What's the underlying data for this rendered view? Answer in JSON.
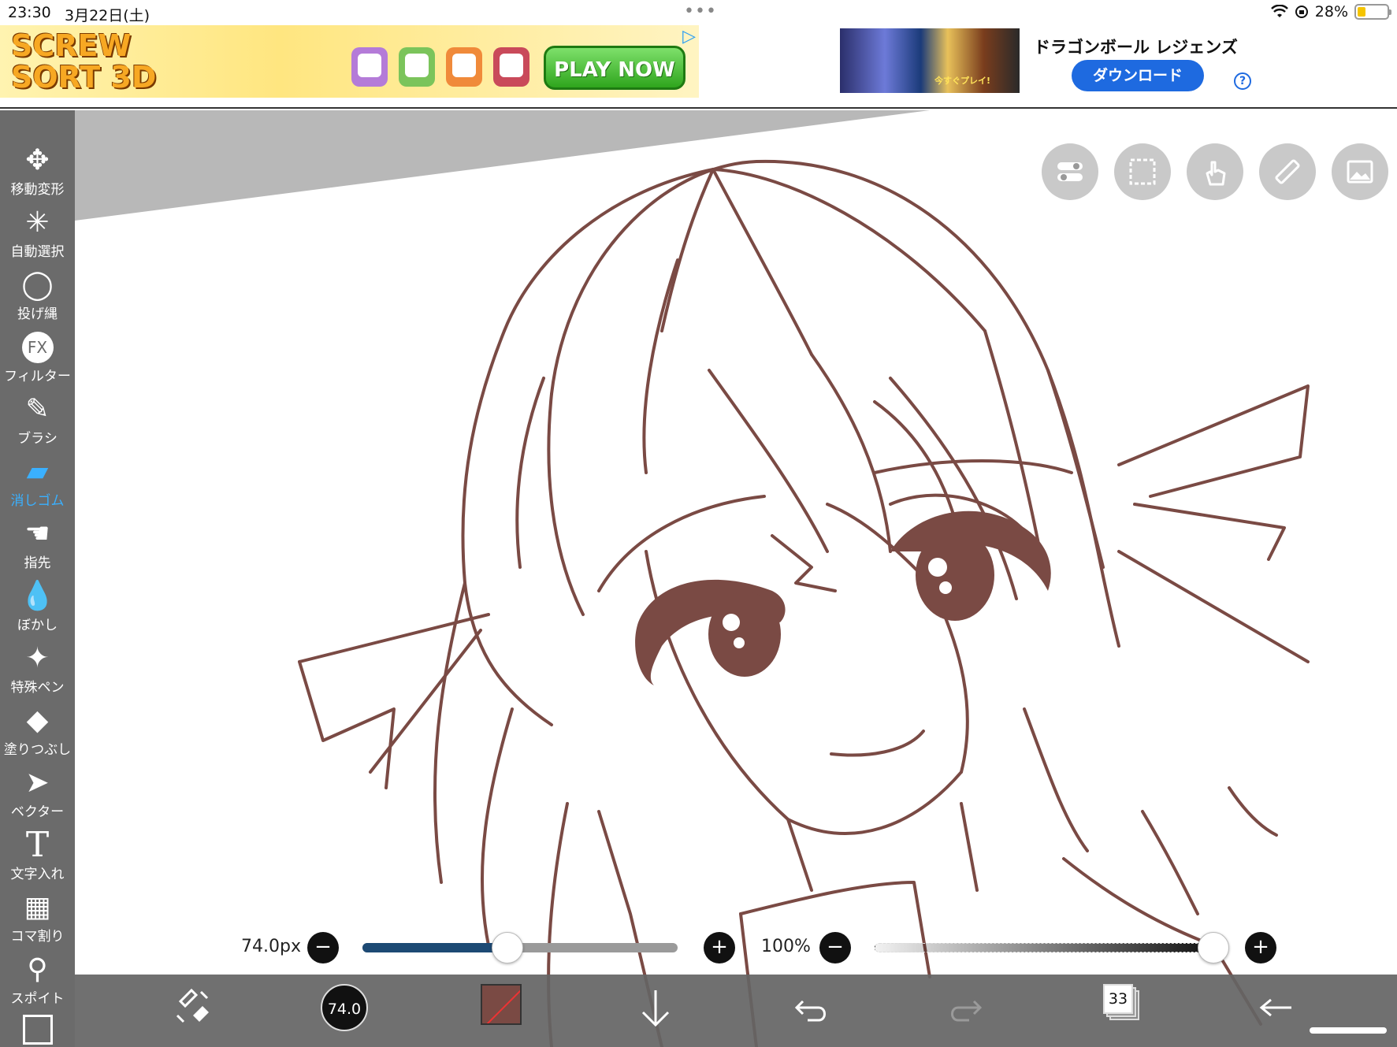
{
  "status": {
    "time": "23:30",
    "date": "3月22日(土)",
    "dots": "•••",
    "battery_pct": "28%",
    "battery_level": 0.28
  },
  "ads": {
    "left": {
      "title_line1": "SCREW",
      "title_line2": "SORT 3D",
      "cta": "PLAY NOW",
      "dice_colors": [
        "#b47bd8",
        "#7bc45b",
        "#f08a3a",
        "#c94a5a"
      ]
    },
    "right": {
      "title": "ドラゴンボール レジェンズ",
      "thumb_caption": "今すぐプレイ!",
      "cta": "ダウンロード",
      "help": "?"
    }
  },
  "toolbar": {
    "items": [
      {
        "label": "移動変形",
        "icon": "move-arrows-icon"
      },
      {
        "label": "自動選択",
        "icon": "magic-wand-icon"
      },
      {
        "label": "投げ縄",
        "icon": "lasso-icon"
      },
      {
        "label": "フィルター",
        "icon": "fx-icon",
        "icon_text": "FX"
      },
      {
        "label": "ブラシ",
        "icon": "brush-icon"
      },
      {
        "label": "消しゴム",
        "icon": "eraser-icon",
        "active": true
      },
      {
        "label": "指先",
        "icon": "finger-icon"
      },
      {
        "label": "ぼかし",
        "icon": "drop-icon"
      },
      {
        "label": "特殊ペン",
        "icon": "sparkle-pen-icon"
      },
      {
        "label": "塗りつぶし",
        "icon": "bucket-icon"
      },
      {
        "label": "ベクター",
        "icon": "vector-arrow-icon"
      },
      {
        "label": "文字入れ",
        "icon": "text-icon",
        "icon_text": "T"
      },
      {
        "label": "コマ割り",
        "icon": "panel-icon"
      },
      {
        "label": "スポイト",
        "icon": "eyedropper-icon"
      }
    ]
  },
  "top_buttons": [
    "toggle-icon",
    "selection-icon",
    "hand-icon",
    "ruler-icon",
    "image-icon"
  ],
  "brush": {
    "size_label": "74.0px",
    "size_level": 0.46,
    "opacity_label": "100%",
    "opacity_level": 1.0,
    "minus": "−",
    "plus": "+"
  },
  "bottom": {
    "brush_size_badge": "74.0",
    "layer_count": "33",
    "color": "#7a4a44"
  }
}
